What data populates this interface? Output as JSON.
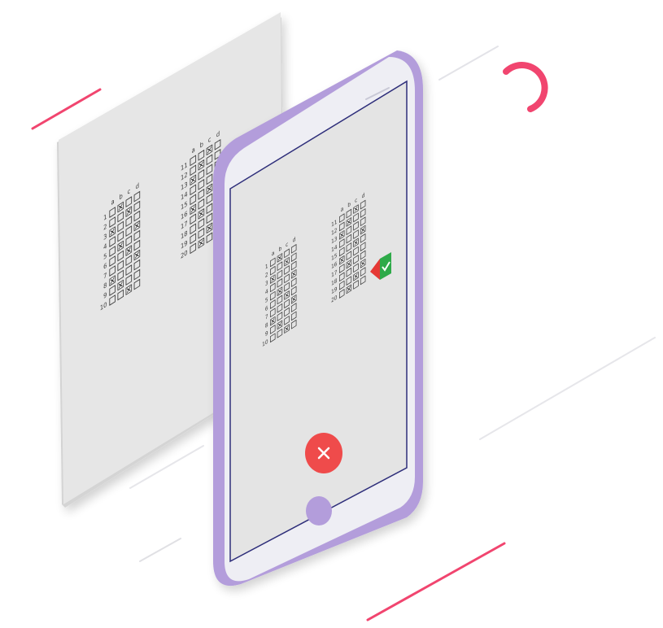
{
  "colors": {
    "background": "#ffffff",
    "paper": "#e6e6e6",
    "paper_edge": "#d4d4d4",
    "phone_body": "#b39ddb",
    "phone_face": "#eeeef4",
    "screen": "#e4e4e4",
    "screen_border": "#2e2e7a",
    "accent_pink": "#f1456f",
    "close_button": "#ef4b4b",
    "home_button": "#b39ddb",
    "mark": "#3a3a3a",
    "logo_red": "#e53935",
    "logo_green": "#2eaa4a"
  },
  "answer_sheet": {
    "letters": [
      "a",
      "b",
      "c",
      "d"
    ],
    "block_1_numbers": [
      "1",
      "2",
      "3",
      "4",
      "5",
      "6",
      "7",
      "8",
      "9",
      "10"
    ],
    "block_2_numbers": [
      "11",
      "12",
      "13",
      "14",
      "15",
      "16",
      "17",
      "18",
      "19",
      "20"
    ],
    "block_1_marks": [
      1,
      2,
      0,
      3,
      1,
      2,
      3,
      0,
      1,
      2
    ],
    "block_2_marks": [
      2,
      1,
      0,
      3,
      2,
      0,
      1,
      3,
      2,
      1
    ]
  },
  "phone": {
    "close_icon": "close-icon",
    "home_icon": "home-button",
    "logo_icon": "check-cross-logo-icon"
  }
}
